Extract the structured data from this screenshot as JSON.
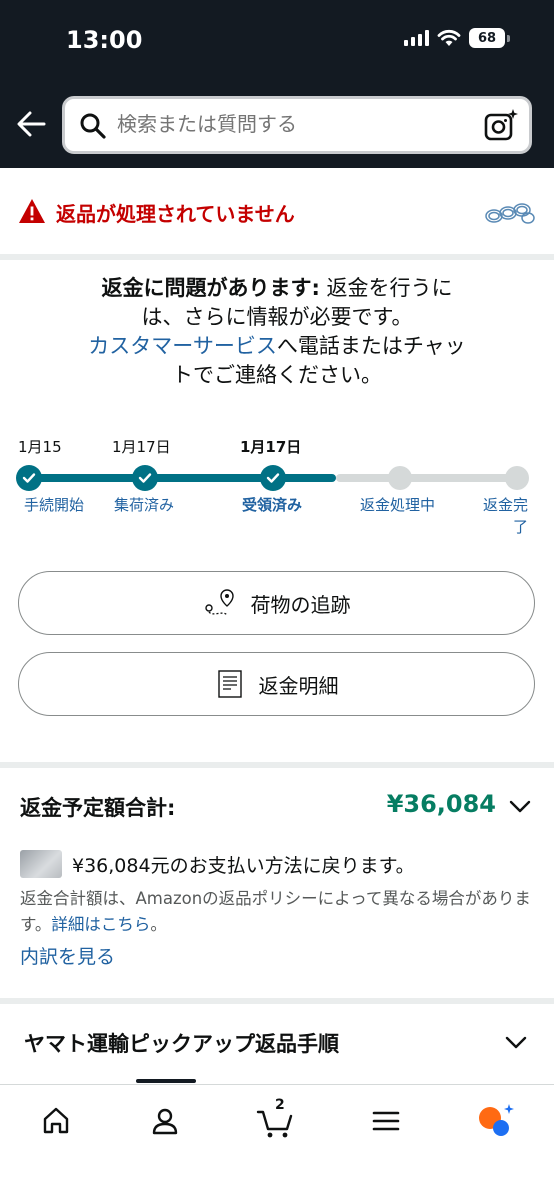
{
  "status_bar": {
    "time": "13:00",
    "battery": "68"
  },
  "search": {
    "placeholder": "検索または質問する"
  },
  "alert": {
    "title": "返品が処理されていません"
  },
  "issue": {
    "bold": "返金に問題があります:",
    "line1": " 返金を行うに",
    "line2": "は、さらに情報が必要です。",
    "link": "カスタマーサービス",
    "line3": "へ電話またはチャッ",
    "line4": "トでご連絡ください。"
  },
  "tracker": {
    "dates": [
      "1月15日",
      "1月17日",
      "1月17日"
    ],
    "steps": [
      {
        "label": "手続開始",
        "status": "done"
      },
      {
        "label": "集荷済み",
        "status": "done"
      },
      {
        "label": "受領済み",
        "status": "done"
      },
      {
        "label": "返金処理中",
        "status": "pending"
      },
      {
        "label": "返金完了",
        "status": "pending"
      }
    ],
    "accent": "#007185"
  },
  "buttons": {
    "track": "荷物の追跡",
    "details": "返金明細"
  },
  "refund": {
    "title": "返金予定額合計:",
    "amount": "¥36,084",
    "card_text": "¥36,084元のお支払い方法に戻ります。",
    "policy": "返金合計額は、Amazonの返品ポリシーによって異なる場合があります。",
    "policy_link": "詳細はこちら",
    "breakdown_link": "内訳を見る"
  },
  "yamato": {
    "title": "ヤマト運輸ピックアップ返品手順"
  },
  "nav": {
    "cart_count": "2"
  }
}
